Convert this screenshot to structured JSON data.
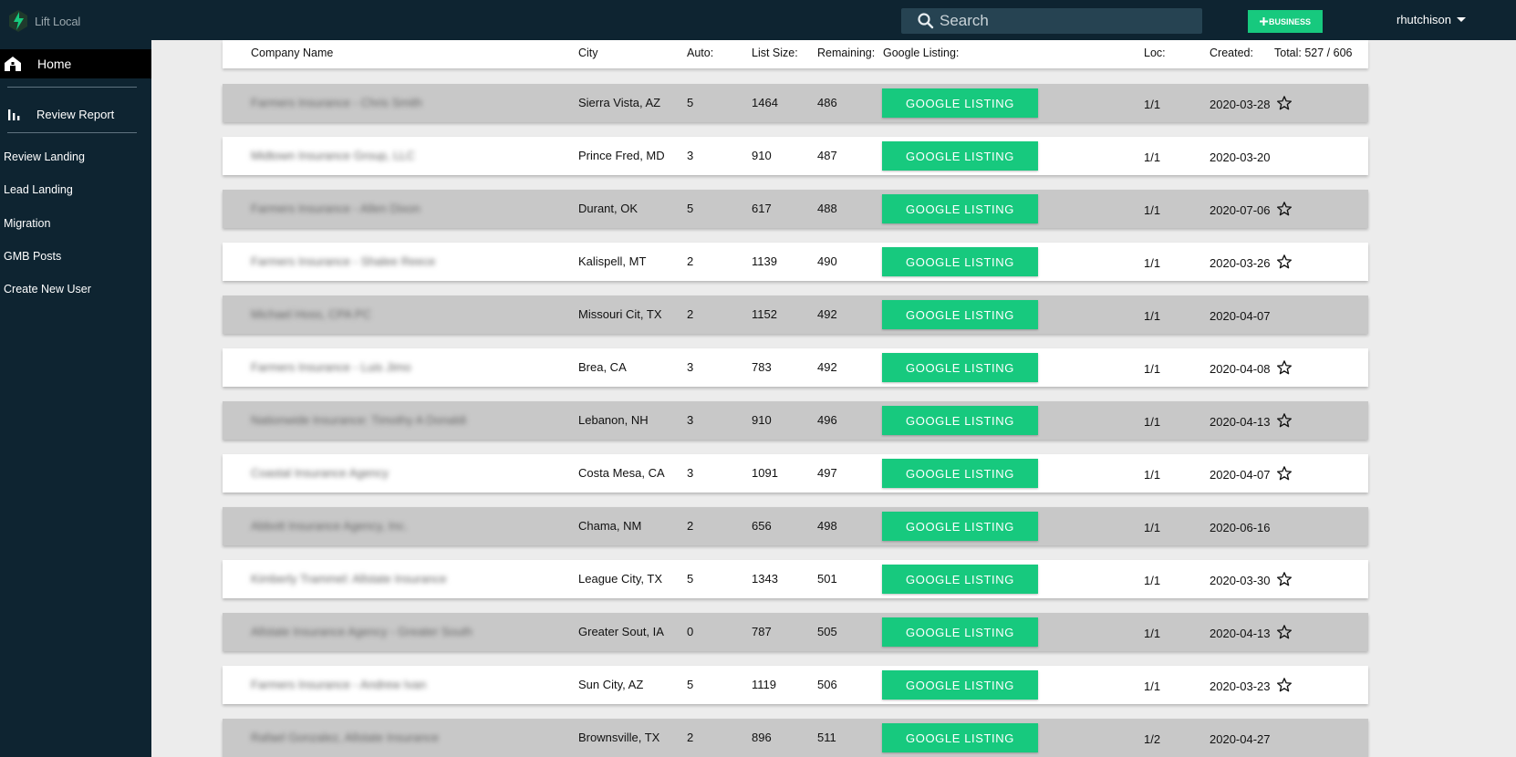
{
  "app": {
    "logo_text": "Lift Local"
  },
  "search": {
    "placeholder": "Search"
  },
  "header": {
    "business_button": "BUSINESS",
    "user": "rhutchison"
  },
  "sidebar": {
    "home": "Home",
    "review_report": "Review Report",
    "links": [
      "Review Landing",
      "Lead Landing",
      "Migration",
      "GMB Posts",
      "Create New User"
    ]
  },
  "table": {
    "headers": {
      "company": "Company Name",
      "city": "City",
      "auto": "Auto:",
      "list_size": "List Size:",
      "remaining": "Remaining:",
      "google": "Google Listing:",
      "loc": "Loc:",
      "created": "Created:",
      "total": "Total: 527 / 606"
    },
    "button_label": "GOOGLE LISTING",
    "rows": [
      {
        "company": "Farmers Insurance - Chris Smith",
        "city": "Sierra Vista, AZ",
        "auto": "5",
        "list": "1464",
        "remaining": "486",
        "loc": "1/1",
        "created": "2020-03-28",
        "star": true
      },
      {
        "company": "Midtown Insurance Group, LLC",
        "city": "Prince Fred, MD",
        "auto": "3",
        "list": "910",
        "remaining": "487",
        "loc": "1/1",
        "created": "2020-03-20",
        "star": false
      },
      {
        "company": "Farmers Insurance - Allen Dixon",
        "city": "Durant, OK",
        "auto": "5",
        "list": "617",
        "remaining": "488",
        "loc": "1/1",
        "created": "2020-07-06",
        "star": true
      },
      {
        "company": "Farmers Insurance - Shalee Reece",
        "city": "Kalispell, MT",
        "auto": "2",
        "list": "1139",
        "remaining": "490",
        "loc": "1/1",
        "created": "2020-03-26",
        "star": true
      },
      {
        "company": "Michael Hoss, CPA PC",
        "city": "Missouri Cit, TX",
        "auto": "2",
        "list": "1152",
        "remaining": "492",
        "loc": "1/1",
        "created": "2020-04-07",
        "star": false
      },
      {
        "company": "Farmers Insurance - Luis Jimo",
        "city": "Brea, CA",
        "auto": "3",
        "list": "783",
        "remaining": "492",
        "loc": "1/1",
        "created": "2020-04-08",
        "star": true
      },
      {
        "company": "Nationwide Insurance: Timothy A Donaldi",
        "city": "Lebanon, NH",
        "auto": "3",
        "list": "910",
        "remaining": "496",
        "loc": "1/1",
        "created": "2020-04-13",
        "star": true
      },
      {
        "company": "Coastal Insurance Agency",
        "city": "Costa Mesa, CA",
        "auto": "3",
        "list": "1091",
        "remaining": "497",
        "loc": "1/1",
        "created": "2020-04-07",
        "star": true
      },
      {
        "company": "Abbott Insurance Agency, Inc.",
        "city": "Chama, NM",
        "auto": "2",
        "list": "656",
        "remaining": "498",
        "loc": "1/1",
        "created": "2020-06-16",
        "star": false
      },
      {
        "company": "Kimberly Trammel: Allstate Insurance",
        "city": "League City, TX",
        "auto": "5",
        "list": "1343",
        "remaining": "501",
        "loc": "1/1",
        "created": "2020-03-30",
        "star": true
      },
      {
        "company": "Allstate Insurance Agency - Greater South",
        "city": "Greater Sout, IA",
        "auto": "0",
        "list": "787",
        "remaining": "505",
        "loc": "1/1",
        "created": "2020-04-13",
        "star": true
      },
      {
        "company": "Farmers Insurance - Andrew Ivan",
        "city": "Sun City, AZ",
        "auto": "5",
        "list": "1119",
        "remaining": "506",
        "loc": "1/1",
        "created": "2020-03-23",
        "star": true
      },
      {
        "company": "Rafael Gonzalez, Allstate Insurance",
        "city": "Brownsville, TX",
        "auto": "2",
        "list": "896",
        "remaining": "511",
        "loc": "1/2",
        "created": "2020-04-27",
        "star": false
      }
    ]
  },
  "colors": {
    "topbar": "#0e2431",
    "accent_green": "#17c97e",
    "row_grey": "#c8c8c8",
    "row_white": "#ffffff"
  },
  "icons": [
    "logo-icon",
    "search-icon",
    "plus-icon",
    "chevron-down-icon",
    "home-icon",
    "bar-chart-icon",
    "star-icon"
  ]
}
